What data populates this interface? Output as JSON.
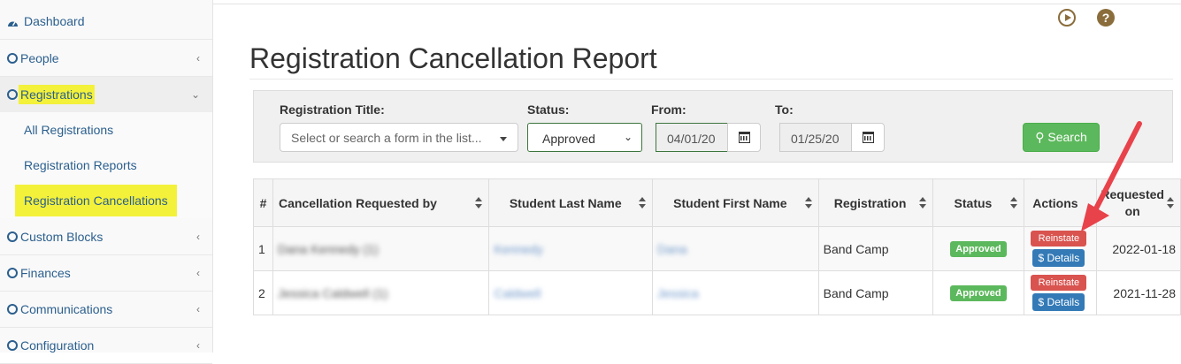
{
  "sidebar": {
    "items": [
      {
        "label": "Dashboard",
        "icon": "dashboard-icon"
      },
      {
        "label": "People",
        "icon": "circle-icon"
      },
      {
        "label": "Registrations",
        "icon": "circle-icon"
      },
      {
        "label": "Custom Blocks",
        "icon": "circle-icon"
      },
      {
        "label": "Finances",
        "icon": "circle-icon"
      },
      {
        "label": "Communications",
        "icon": "circle-icon"
      },
      {
        "label": "Configuration",
        "icon": "circle-icon"
      }
    ],
    "sub_items": [
      {
        "label": "All Registrations"
      },
      {
        "label": "Registration Reports"
      },
      {
        "label": "Registration Cancellations"
      }
    ]
  },
  "header": {
    "play_icon": "play-circle-icon",
    "help_icon": "question-circle-icon",
    "help_glyph": "?"
  },
  "page": {
    "title": "Registration Cancellation Report"
  },
  "filters": {
    "registration_title_label": "Registration Title:",
    "registration_title_placeholder": "Select or search a form in the list...",
    "status_label": "Status:",
    "status_value": "Approved",
    "from_label": "From:",
    "from_value": "04/01/20",
    "to_label": "To:",
    "to_value": "01/25/20",
    "search_label": "Search"
  },
  "table": {
    "headers": [
      "#",
      "Cancellation Requested by",
      "Student Last Name",
      "Student First Name",
      "Registration",
      "Status",
      "Actions",
      "Requested on"
    ],
    "rows": [
      {
        "num": "1",
        "requested_by": "Dana Kennedy (1)",
        "last": "Kennedy",
        "first": "Dana",
        "registration": "Band Camp",
        "status": "Approved",
        "reinstate": "Reinstate",
        "details": "Details",
        "requested_on": "2022-01-18"
      },
      {
        "num": "2",
        "requested_by": "Jessica Caldwell (1)",
        "last": "Caldwell",
        "first": "Jessica",
        "registration": "Band Camp",
        "status": "Approved",
        "reinstate": "Reinstate",
        "details": "Details",
        "requested_on": "2021-11-28"
      }
    ]
  },
  "colors": {
    "accent": "#2b5f8e",
    "success": "#5cb85c",
    "danger": "#d9534f",
    "primary": "#337ab7",
    "highlight": "#f3f13a",
    "annotation_arrow": "#e8424b"
  }
}
